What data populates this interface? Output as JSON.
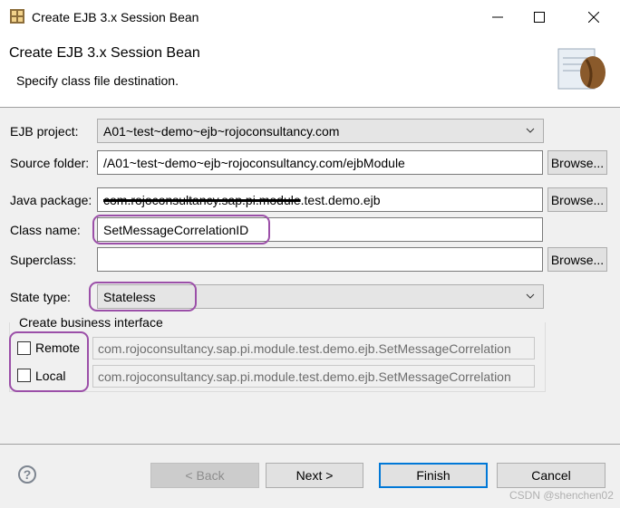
{
  "window": {
    "title": "Create EJB 3.x Session Bean"
  },
  "header": {
    "title": "Create EJB 3.x Session Bean",
    "subtitle": "Specify class file destination."
  },
  "form": {
    "ejb_project": {
      "label": "EJB project:",
      "value": "A01~test~demo~ejb~rojoconsultancy.com"
    },
    "source_folder": {
      "label": "Source folder:",
      "value": "/A01~test~demo~ejb~rojoconsultancy.com/ejbModule",
      "browse": "Browse..."
    },
    "java_package": {
      "label": "Java package:",
      "value_struck": "com.rojoconsultancy.sap.pi.module",
      "value_rest": ".test.demo.ejb",
      "browse": "Browse..."
    },
    "class_name": {
      "label": "Class name:",
      "value": "SetMessageCorrelationID"
    },
    "superclass": {
      "label": "Superclass:",
      "value": "",
      "browse": "Browse..."
    },
    "state_type": {
      "label": "State type:",
      "value": "Stateless"
    }
  },
  "business_interface": {
    "legend": "Create business interface",
    "remote": {
      "label": "Remote",
      "checked": false,
      "value": "com.rojoconsultancy.sap.pi.module.test.demo.ejb.SetMessageCorrelation"
    },
    "local": {
      "label": "Local",
      "checked": false,
      "value": "com.rojoconsultancy.sap.pi.module.test.demo.ejb.SetMessageCorrelation"
    }
  },
  "buttons": {
    "help": "?",
    "back": "< Back",
    "next": "Next >",
    "finish": "Finish",
    "cancel": "Cancel"
  },
  "watermark": "CSDN @shenchen02",
  "colors": {
    "highlight": "#9b4fa8",
    "finish_border": "#0078d7"
  }
}
